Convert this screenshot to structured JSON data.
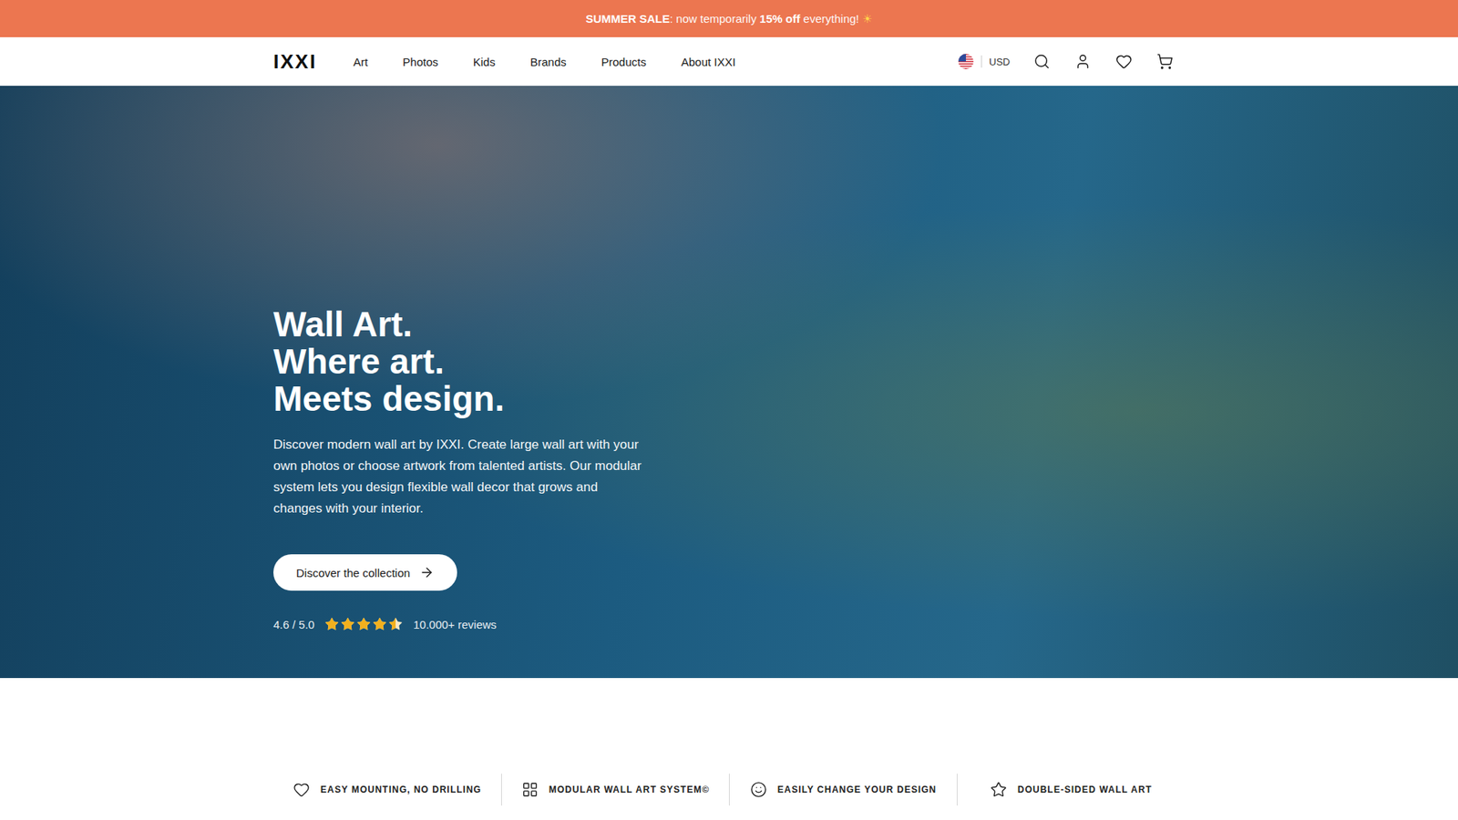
{
  "promo": {
    "parts": [
      {
        "text": "SUMMER SALE",
        "bold": true,
        "emoji": false
      },
      {
        "text": ": now temporarily ",
        "bold": false,
        "emoji": false
      },
      {
        "text": "15% off",
        "bold": true,
        "emoji": false
      },
      {
        "text": " everything! ",
        "bold": false,
        "emoji": false
      },
      {
        "text": "☀",
        "bold": false,
        "emoji": true
      }
    ]
  },
  "header": {
    "logo": "IXXI",
    "nav": [
      "Art",
      "Photos",
      "Kids",
      "Brands",
      "Products",
      "About IXXI"
    ],
    "currency": "USD"
  },
  "hero": {
    "title_lines": [
      "Wall Art.",
      "Where art.",
      "Meets design."
    ],
    "description": "Discover modern wall art by IXXI. Create large wall art with your own photos or choose artwork from talented artists. Our modular system lets you design flexible wall decor that grows and changes with your interior.",
    "button": "Discover the collection",
    "rating": {
      "score": "4.6 / 5.0",
      "stars": 4.5,
      "reviews": "10.000+ reviews"
    }
  },
  "features": [
    {
      "label": "EASY MOUNTING, NO DRILLING"
    },
    {
      "label": "MODULAR WALL ART SYSTEM©"
    },
    {
      "label": "EASILY CHANGE YOUR DESIGN"
    },
    {
      "label": "DOUBLE-SIDED WALL ART"
    }
  ]
}
